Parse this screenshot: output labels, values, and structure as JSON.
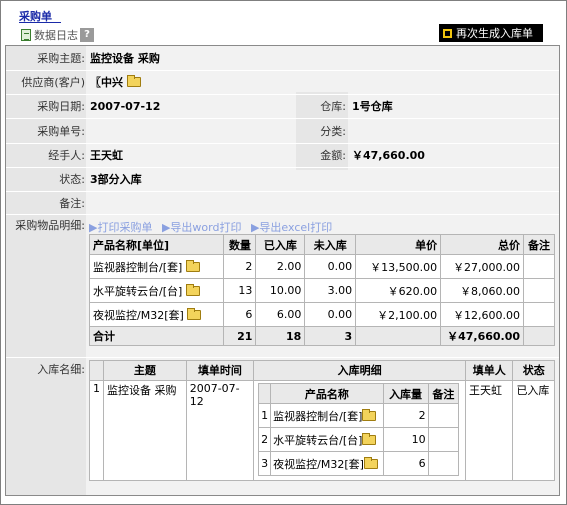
{
  "header": {
    "title": "采购单",
    "data_log": "数据日志",
    "help": "?",
    "regenerate_button": "再次生成入库单"
  },
  "form": {
    "subject_label": "采购主题:",
    "subject_value": "监控设备  采购",
    "supplier_label": "供应商(客户)",
    "supplier_value": "〖中兴",
    "purchase_date_label": "采购日期:",
    "purchase_date_value": "2007-07-12",
    "warehouse_label": "仓库:",
    "warehouse_value": "1号仓库",
    "order_no_label": "采购单号:",
    "order_no_value": "",
    "category_label": "分类:",
    "category_value": "",
    "handler_label": "经手人:",
    "handler_value": "王天虹",
    "amount_label": "金额:",
    "amount_value": "￥47,660.00",
    "status_label": "状态:",
    "status_value": "3部分入库",
    "remark_label": "备注:",
    "remark_value": ""
  },
  "items_section": {
    "label": "采购物品明细:",
    "links": [
      "▶打印采购单",
      "▶导出word打印",
      "▶导出excel打印"
    ],
    "columns": [
      "产品名称[单位]",
      "数量",
      "已入库",
      "未入库",
      "单价",
      "总价",
      "备注"
    ],
    "rows": [
      {
        "name": "监视器控制台/[套]",
        "qty": "2",
        "stocked": "2.00",
        "pending": "0.00",
        "unit_price": "￥13,500.00",
        "total": "￥27,000.00",
        "remark": ""
      },
      {
        "name": "水平旋转云台/[台]",
        "qty": "13",
        "stocked": "10.00",
        "pending": "3.00",
        "unit_price": "￥620.00",
        "total": "￥8,060.00",
        "remark": ""
      },
      {
        "name": "夜视监控/M32[套]",
        "qty": "6",
        "stocked": "6.00",
        "pending": "0.00",
        "unit_price": "￥2,100.00",
        "total": "￥12,600.00",
        "remark": ""
      }
    ],
    "total_row": {
      "label": "合计",
      "qty": "21",
      "stocked": "18",
      "pending": "3",
      "total": "￥47,660.00"
    }
  },
  "storage_section": {
    "label": "入库名细:",
    "columns": [
      "主题",
      "填单时间",
      "入库明细",
      "填单人",
      "状态"
    ],
    "record": {
      "index": "1",
      "subject": "监控设备  采购",
      "date": "2007-07-12",
      "handler": "王天虹",
      "status": "已入库",
      "detail_columns": [
        "产品名称",
        "入库量",
        "备注"
      ],
      "details": [
        {
          "index": "1",
          "name": "监视器控制台/[套]",
          "qty": "2",
          "remark": ""
        },
        {
          "index": "2",
          "name": "水平旋转云台/[台]",
          "qty": "10",
          "remark": ""
        },
        {
          "index": "3",
          "name": "夜视监控/M32[套]",
          "qty": "6",
          "remark": ""
        }
      ]
    }
  }
}
